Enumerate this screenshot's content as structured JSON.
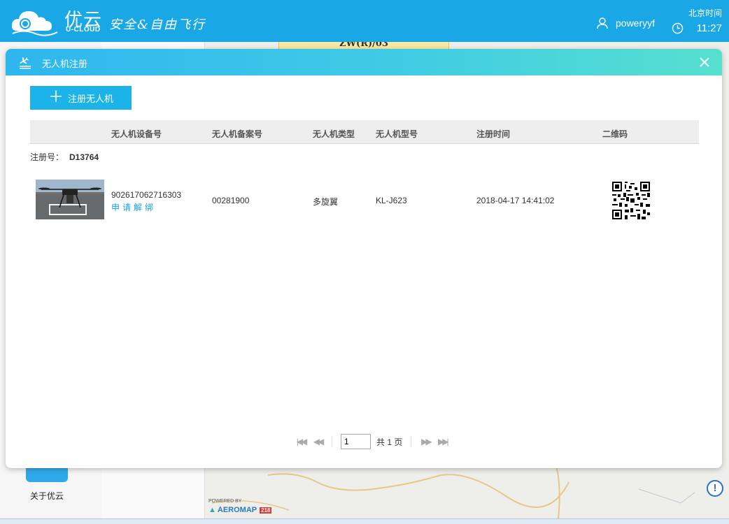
{
  "header": {
    "brand_cn": "优云",
    "brand_en": "U-CLOUD",
    "slogan": "安全&自由飞行",
    "username": "poweryyf",
    "clock_label": "北京时间",
    "clock_time": "11:27"
  },
  "map": {
    "zone_label": "ZW(R)/03",
    "powered_by": "POWERED BY",
    "aeromap": "AEROMAP",
    "aeromap_badge": "218",
    "about_label": "关于优云"
  },
  "modal": {
    "title": "无人机注册",
    "register_button": "注册无人机",
    "columns": [
      "无人机设备号",
      "无人机备案号",
      "无人机类型",
      "无人机型号",
      "注册时间",
      "二维码"
    ],
    "registration_label": "注册号：",
    "registration_no": "D13764",
    "rows": [
      {
        "device_no": "902617062716303",
        "unbind_label": "申请解绑",
        "record_no": "00281900",
        "type": "多旋翼",
        "model": "KL-J623",
        "registered_at": "2018-04-17 14:41:02"
      }
    ],
    "pager": {
      "current_page": "1",
      "total_text": "共 1 页"
    }
  },
  "colors": {
    "header_bg": "#1aa7e6",
    "accent": "#1bb3e8",
    "link": "#1aa0e0"
  }
}
